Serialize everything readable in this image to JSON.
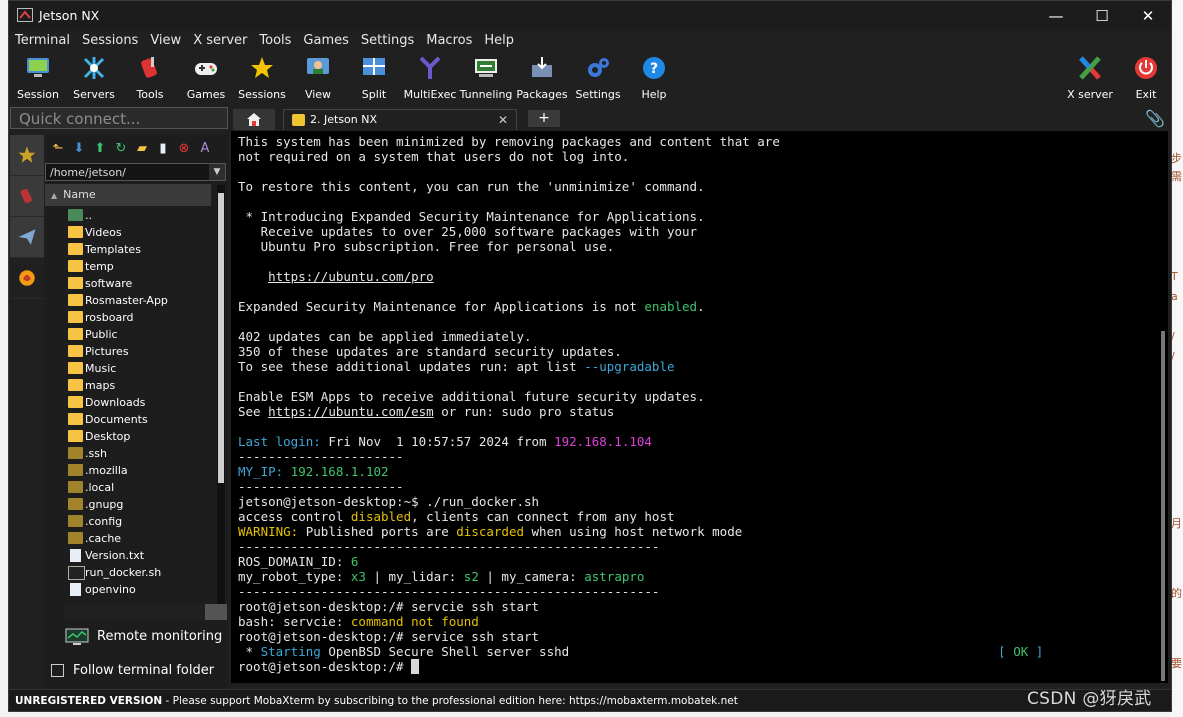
{
  "window": {
    "title": "Jetson NX",
    "minimize": "—",
    "maximize": "☐",
    "close": "✕"
  },
  "menu": [
    "Terminal",
    "Sessions",
    "View",
    "X server",
    "Tools",
    "Games",
    "Settings",
    "Macros",
    "Help"
  ],
  "toolbar": {
    "session": "Session",
    "servers": "Servers",
    "tools": "Tools",
    "games": "Games",
    "sessions": "Sessions",
    "view": "View",
    "split": "Split",
    "multiexec": "MultiExec",
    "tunneling": "Tunneling",
    "packages": "Packages",
    "settings": "Settings",
    "help": "Help",
    "xserver": "X server",
    "exit": "Exit"
  },
  "quick_connect": {
    "placeholder": "Quick connect..."
  },
  "browser": {
    "path": "/home/jetson/",
    "column": "Name",
    "items": [
      {
        "name": "..",
        "kind": "up"
      },
      {
        "name": "Videos",
        "kind": "folder"
      },
      {
        "name": "Templates",
        "kind": "folder"
      },
      {
        "name": "temp",
        "kind": "folder"
      },
      {
        "name": "software",
        "kind": "folder"
      },
      {
        "name": "Rosmaster-App",
        "kind": "folder"
      },
      {
        "name": "rosboard",
        "kind": "folder"
      },
      {
        "name": "Public",
        "kind": "folder"
      },
      {
        "name": "Pictures",
        "kind": "folder"
      },
      {
        "name": "Music",
        "kind": "folder"
      },
      {
        "name": "maps",
        "kind": "folder"
      },
      {
        "name": "Downloads",
        "kind": "folder"
      },
      {
        "name": "Documents",
        "kind": "folder"
      },
      {
        "name": "Desktop",
        "kind": "folder"
      },
      {
        "name": ".ssh",
        "kind": "hidden"
      },
      {
        "name": ".mozilla",
        "kind": "hidden"
      },
      {
        "name": ".local",
        "kind": "hidden"
      },
      {
        "name": ".gnupg",
        "kind": "hidden"
      },
      {
        "name": ".config",
        "kind": "hidden"
      },
      {
        "name": ".cache",
        "kind": "hidden"
      },
      {
        "name": "Version.txt",
        "kind": "file"
      },
      {
        "name": "run_docker.sh",
        "kind": "script"
      },
      {
        "name": "openvino",
        "kind": "file"
      }
    ],
    "remote_monitoring": "Remote monitoring",
    "follow_folder": "Follow terminal folder"
  },
  "tabs": {
    "session_tab": "2. Jetson NX",
    "close": "✕",
    "new": "+"
  },
  "terminal": {
    "l01": "This system has been minimized by removing packages and content that are",
    "l02": "not required on a system that users do not log into.",
    "l04": "To restore this content, you can run the 'unminimize' command.",
    "l06": " * Introducing Expanded Security Maintenance for Applications.",
    "l07": "   Receive updates to over 25,000 software packages with your",
    "l08": "   Ubuntu Pro subscription. Free for personal use.",
    "l10_url": "https://ubuntu.com/pro",
    "l12a": "Expanded Security Maintenance for Applications is not ",
    "l12b": "enabled",
    "l12c": ".",
    "l14": "402 updates can be applied immediately.",
    "l15": "350 of these updates are standard security updates.",
    "l16a": "To see these additional updates run: apt list ",
    "l16b": "--upgradable",
    "l18": "Enable ESM Apps to receive additional future security updates.",
    "l19a": "See ",
    "l19b": "https://ubuntu.com/esm",
    "l19c": " or run: sudo pro status",
    "l21a": "Last login:",
    "l21b": " Fri Nov  1 10:57:57 2024 from ",
    "l21c": "192.168.1.104",
    "l22": "----------------------",
    "l23a": "MY_IP:",
    "l23b": " 192.168.1.102",
    "l24": "----------------------",
    "l25": "jetson@jetson-desktop:~$ ./run_docker.sh",
    "l26a": "access control ",
    "l26b": "disabled",
    ", clients": "",
    "l26c": ", clients can connect from any host",
    "l27a": "WARNING:",
    "l27b": " Published ports are ",
    "l27c": "discarded",
    "l27d": " when using host network mode",
    "l28": "--------------------------------------------------------",
    "l29a": "ROS_DOMAIN_ID: ",
    "l29b": "6",
    "l30a": "my_robot_type: ",
    "l30b": "x3",
    "l30c": " | my_lidar: ",
    "l30d": "s2",
    "l30e": " | my_camera: ",
    "l30f": "astrapro",
    "l31": "--------------------------------------------------------",
    "l32": "root@jetson-desktop:/# servcie ssh start",
    "l33a": "bash: servcie: ",
    "l33b": "command not found",
    "l34": "root@jetson-desktop:/# service ssh start",
    "l35a": " * ",
    "l35b": "Starting",
    "l35c": " OpenBSD Secure Shell server sshd",
    "l35ok_a": "[ ",
    "l35ok_b": "OK",
    "l35ok_c": " ]",
    "l36": "root@jetson-desktop:/# "
  },
  "status": {
    "unregistered": "UNREGISTERED VERSION",
    "message": "  -  Please support MobaXterm by subscribing to the professional edition here:  ",
    "link": "https://mobaxterm.mobatek.net"
  },
  "watermark": "CSDN @犽戾武",
  "colors": {
    "accent_green": "#3ec46d",
    "accent_cyan": "#3da8d8",
    "accent_magenta": "#e040e0",
    "accent_yellow": "#e5c100",
    "folder": "#f6c343"
  }
}
